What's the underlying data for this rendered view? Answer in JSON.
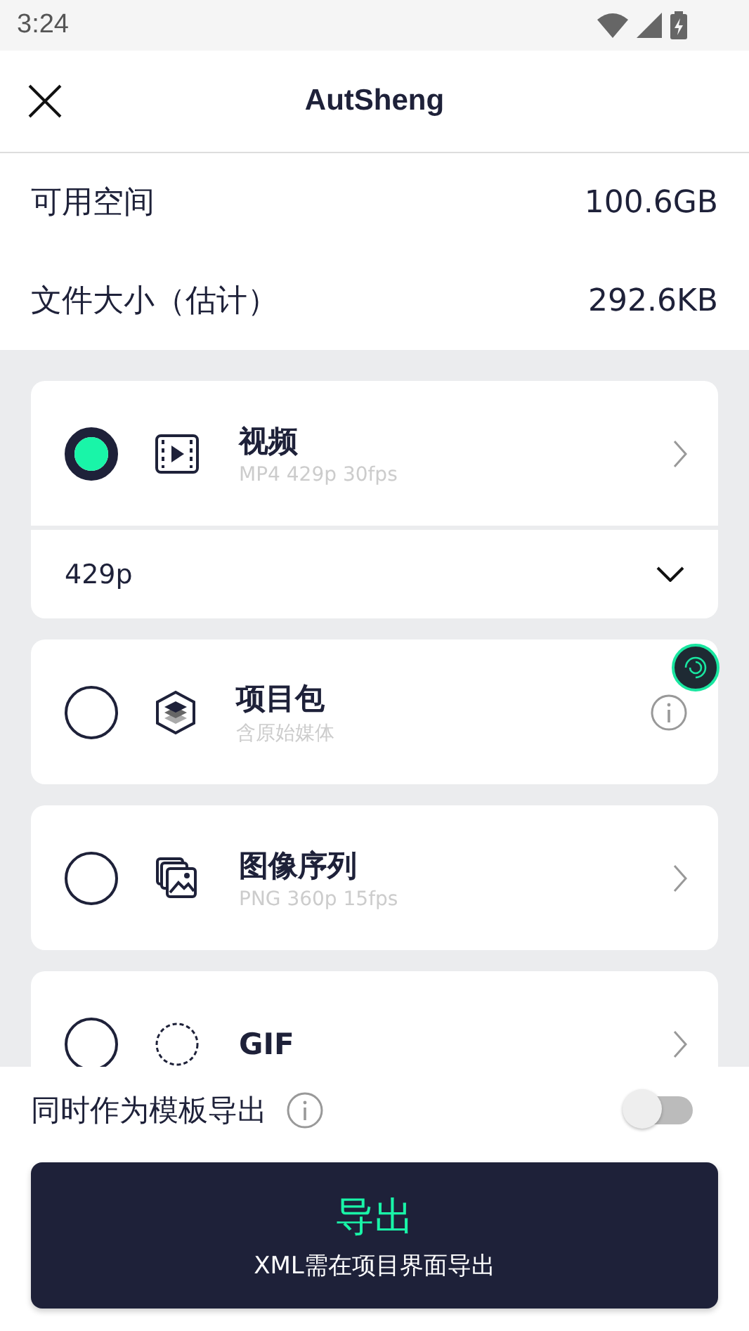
{
  "status_bar": {
    "time": "3:24"
  },
  "header": {
    "title": "AutSheng"
  },
  "info_rows": [
    {
      "label": "可用空间",
      "value": "100.6GB"
    },
    {
      "label": "文件大小（估计）",
      "value": "292.6KB"
    }
  ],
  "options": [
    {
      "kind": "video",
      "title": "视频",
      "subtitle": "MP4 429p 30fps",
      "selected": true,
      "info": false,
      "dropdown": {
        "value": "429p"
      }
    },
    {
      "kind": "package",
      "title": "项目包",
      "subtitle": "含原始媒体",
      "selected": false,
      "info": true
    },
    {
      "kind": "images",
      "title": "图像序列",
      "subtitle": "PNG 360p 15fps",
      "selected": false,
      "info": false
    },
    {
      "kind": "gif",
      "title": "GIF",
      "selected": false,
      "info": false
    }
  ],
  "template_export": {
    "label": "同时作为模板导出",
    "on": false
  },
  "export_button": {
    "label": "导出",
    "note": "XML需在项目界面导出"
  }
}
